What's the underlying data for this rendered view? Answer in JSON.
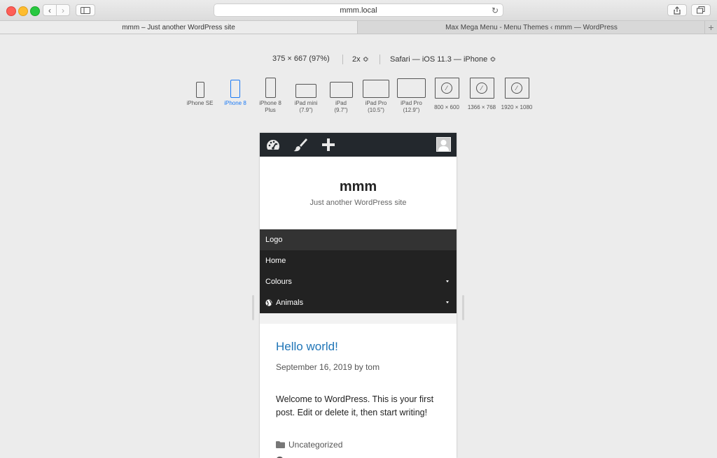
{
  "browser": {
    "url": "mmm.local",
    "tabs": [
      {
        "label": "mmm – Just another WordPress site"
      },
      {
        "label": "Max Mega Menu - Menu Themes ‹ mmm — WordPress"
      }
    ],
    "add_tab_label": "+",
    "back_glyph": "‹",
    "forward_glyph": "›"
  },
  "responsive": {
    "dimensions": "375 × 667  (97%)",
    "scale": "2x ≎",
    "user_agent": "Safari — iOS 11.3 — iPhone ≎",
    "devices": [
      {
        "label": "iPhone SE"
      },
      {
        "label": "iPhone 8"
      },
      {
        "label": "iPhone 8\nPlus"
      },
      {
        "label": "iPad mini\n(7.9\")"
      },
      {
        "label": "iPad\n(9.7\")"
      },
      {
        "label": "iPad Pro\n(10.5\")"
      },
      {
        "label": "iPad Pro\n(12.9\")"
      },
      {
        "label": "800 × 600"
      },
      {
        "label": "1366 × 768"
      },
      {
        "label": "1920 × 1080"
      }
    ],
    "active_device": "iPhone 8",
    "accent_color": "#1b7af5"
  },
  "site": {
    "title": "mmm",
    "description": "Just another WordPress site",
    "menu": [
      {
        "label": "Logo"
      },
      {
        "label": "Home"
      },
      {
        "label": "Colours"
      },
      {
        "label": "Animals"
      }
    ],
    "post": {
      "title": "Hello world!",
      "meta": "September 16, 2019 by tom",
      "body": "Welcome to WordPress. This is your first post. Edit or delete it, then start writing!",
      "category": "Uncategorized"
    }
  },
  "icons": {
    "admin_bar": [
      "dashboard-icon",
      "brush-icon",
      "plus-icon"
    ],
    "menu_globe": "globe-icon",
    "post_category": "folder-icon"
  },
  "colors": {
    "admin_bar": "#23282d",
    "menu_bg": "#222222",
    "link": "#1f75b7"
  }
}
